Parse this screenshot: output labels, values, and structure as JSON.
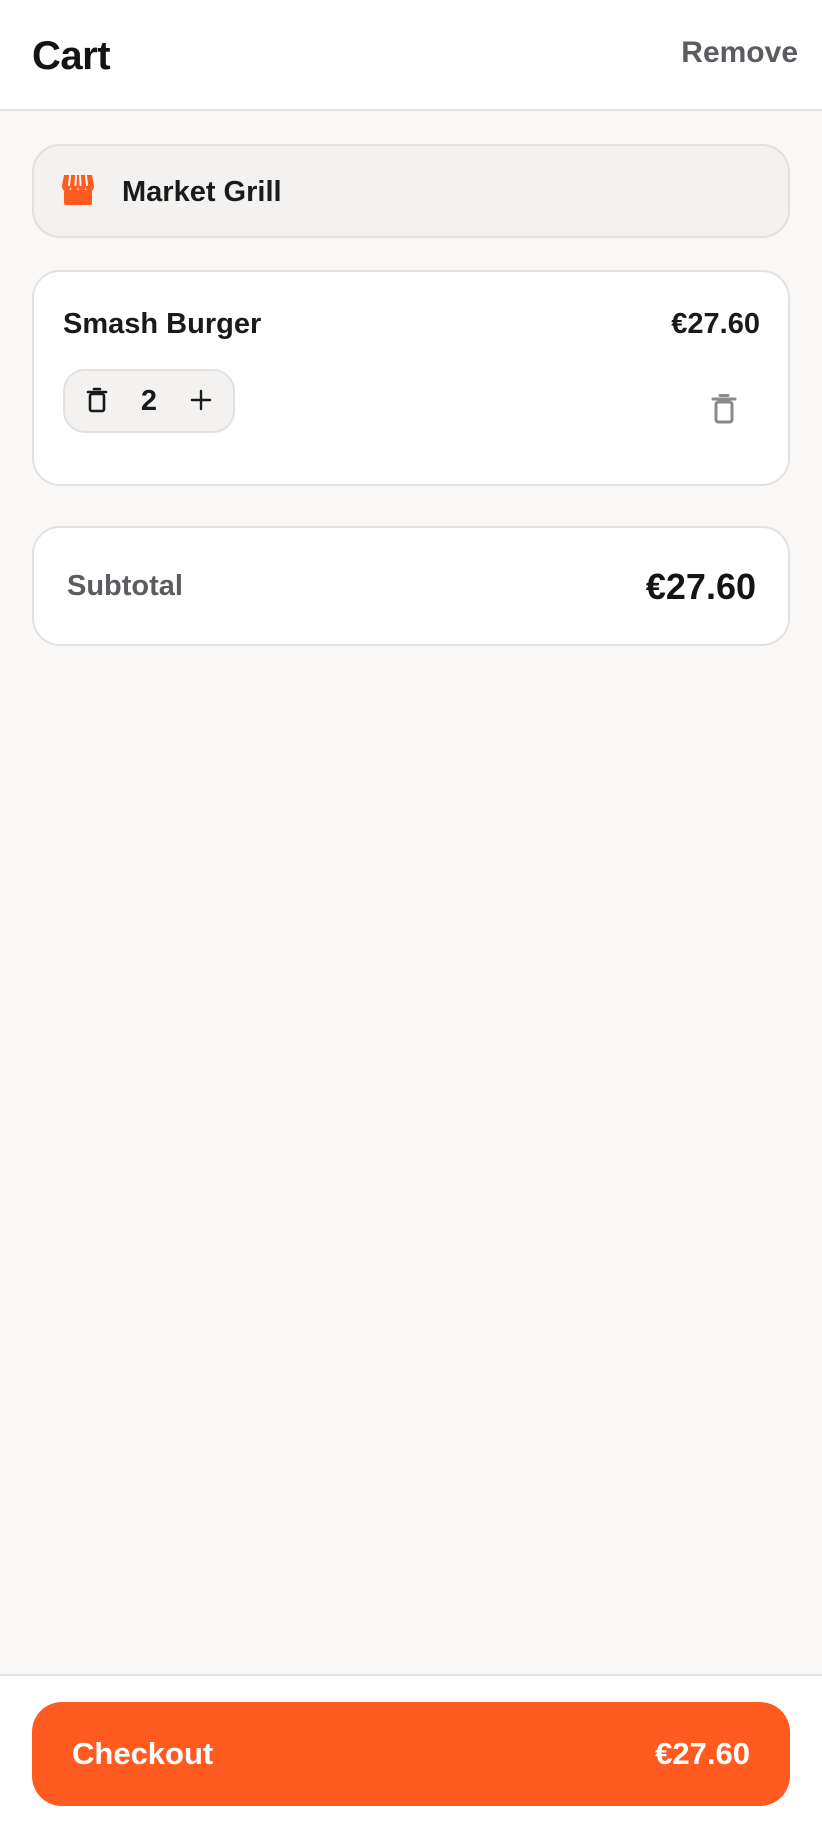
{
  "header": {
    "title": "Cart",
    "action_label": "Remove"
  },
  "restaurant": {
    "name": "Market Grill",
    "icon": "store-icon"
  },
  "items": [
    {
      "name": "Smash Burger",
      "price": "€27.60",
      "quantity": "2",
      "decrement_icon": "trash-icon",
      "increment_icon": "plus-icon",
      "remove_icon": "trash-icon"
    }
  ],
  "summary": {
    "subtotal_label": "Subtotal",
    "subtotal_value": "€27.60"
  },
  "footer": {
    "checkout_label": "Checkout",
    "checkout_total": "€27.60"
  },
  "colors": {
    "accent": "#ff5a1f",
    "text_primary": "#1a1a1a",
    "text_secondary": "#5b5b60",
    "background": "#f9f8f6"
  }
}
